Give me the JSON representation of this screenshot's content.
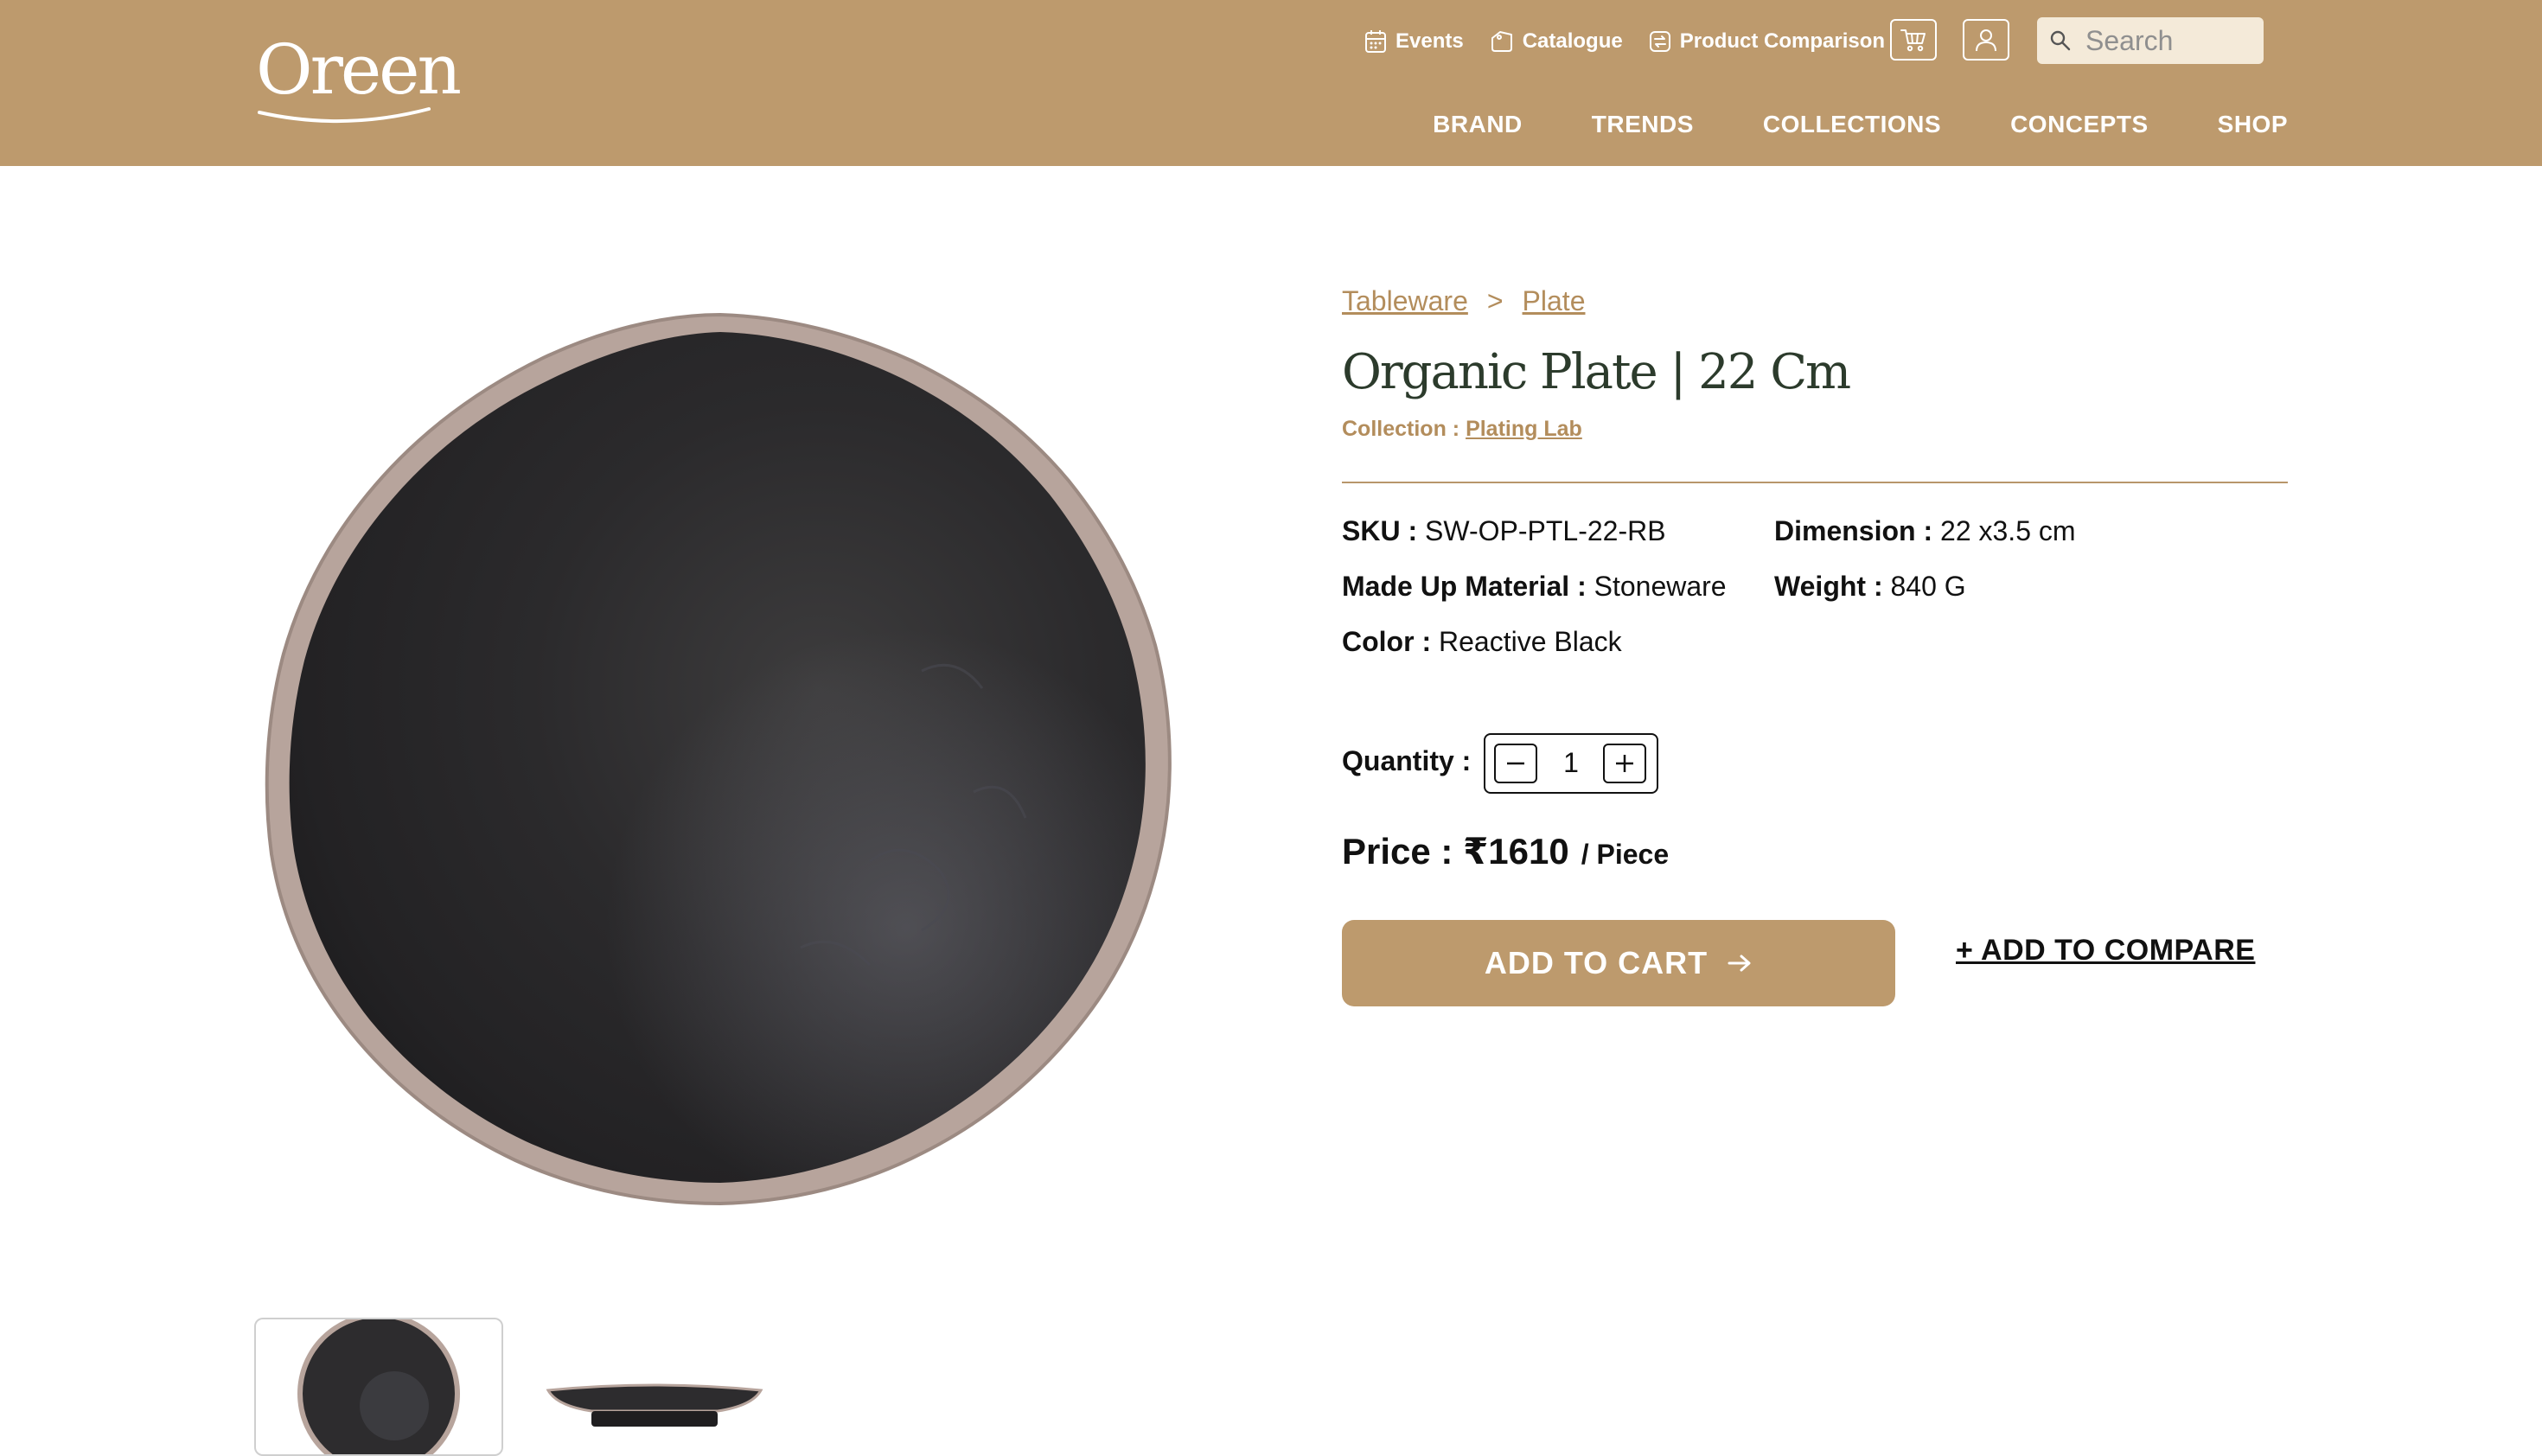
{
  "brand": {
    "logo_text": "Oreen"
  },
  "header": {
    "top_links": [
      {
        "label": "Events",
        "icon": "calendar-icon"
      },
      {
        "label": "Catalogue",
        "icon": "tag-icon"
      },
      {
        "label": "Product Comparison",
        "icon": "compare-icon"
      }
    ],
    "cart_icon": "cart-icon",
    "account_icon": "user-icon",
    "search": {
      "placeholder": "Search",
      "value": ""
    },
    "main_nav": [
      "BRAND",
      "TRENDS",
      "COLLECTIONS",
      "CONCEPTS",
      "SHOP"
    ],
    "colors": {
      "header_bg": "#bd9a6d",
      "accent": "#b38d5c",
      "title": "#2c3b2c"
    }
  },
  "product": {
    "breadcrumb": [
      "Tableware",
      "Plate"
    ],
    "breadcrumb_separator": ">",
    "title": "Organic Plate | 22 Cm",
    "collection_label": "Collection :",
    "collection_name": "Plating Lab",
    "specs": {
      "sku": {
        "label": "SKU :",
        "value": "SW-OP-PTL-22-RB"
      },
      "dimension": {
        "label": "Dimension :",
        "value": "22 x3.5 cm"
      },
      "material": {
        "label": "Made Up Material :",
        "value": "Stoneware"
      },
      "weight": {
        "label": "Weight :",
        "value": "840 G"
      },
      "color": {
        "label": "Color :",
        "value": "Reactive Black"
      }
    },
    "quantity": {
      "label": "Quantity :",
      "value": "1"
    },
    "price": {
      "text": "Price : ₹1610",
      "unit": "/ Piece"
    },
    "add_to_cart_label": "ADD TO CART",
    "add_to_compare_label": "+ ADD TO COMPARE"
  }
}
